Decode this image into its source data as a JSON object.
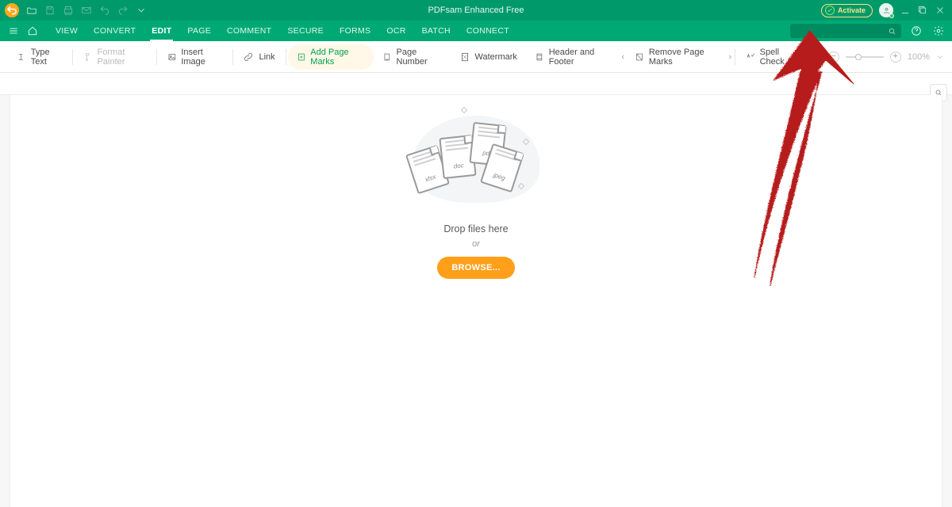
{
  "app_title": "PDFsam Enhanced Free",
  "titlebar": {
    "activate_label": "Activate"
  },
  "nav": {
    "tabs": [
      "VIEW",
      "CONVERT",
      "EDIT",
      "PAGE",
      "COMMENT",
      "SECURE",
      "FORMS",
      "OCR",
      "BATCH",
      "CONNECT"
    ],
    "active_index": 2
  },
  "ribbon": {
    "type_text": "Type Text",
    "format_painter": "Format Painter",
    "insert_image": "Insert Image",
    "link": "Link",
    "add_page_marks": "Add Page Marks",
    "page_number": "Page Number",
    "watermark": "Watermark",
    "header_footer": "Header and Footer",
    "remove_page_marks": "Remove Page Marks",
    "spell_check": "Spell Check",
    "zoom_value": "100%"
  },
  "dropzone": {
    "drop_text": "Drop files here",
    "or_text": "or",
    "browse_label": "BROWSE...",
    "sheet_labels": [
      "xlsx",
      "doc",
      "pdf",
      "jpeg"
    ]
  },
  "colors": {
    "brand_green": "#00a974",
    "brand_green_dark": "#009a6a",
    "accent_orange": "#ff9f1a",
    "highlight_green": "#00a050",
    "arrow_red": "#b71f1f"
  }
}
